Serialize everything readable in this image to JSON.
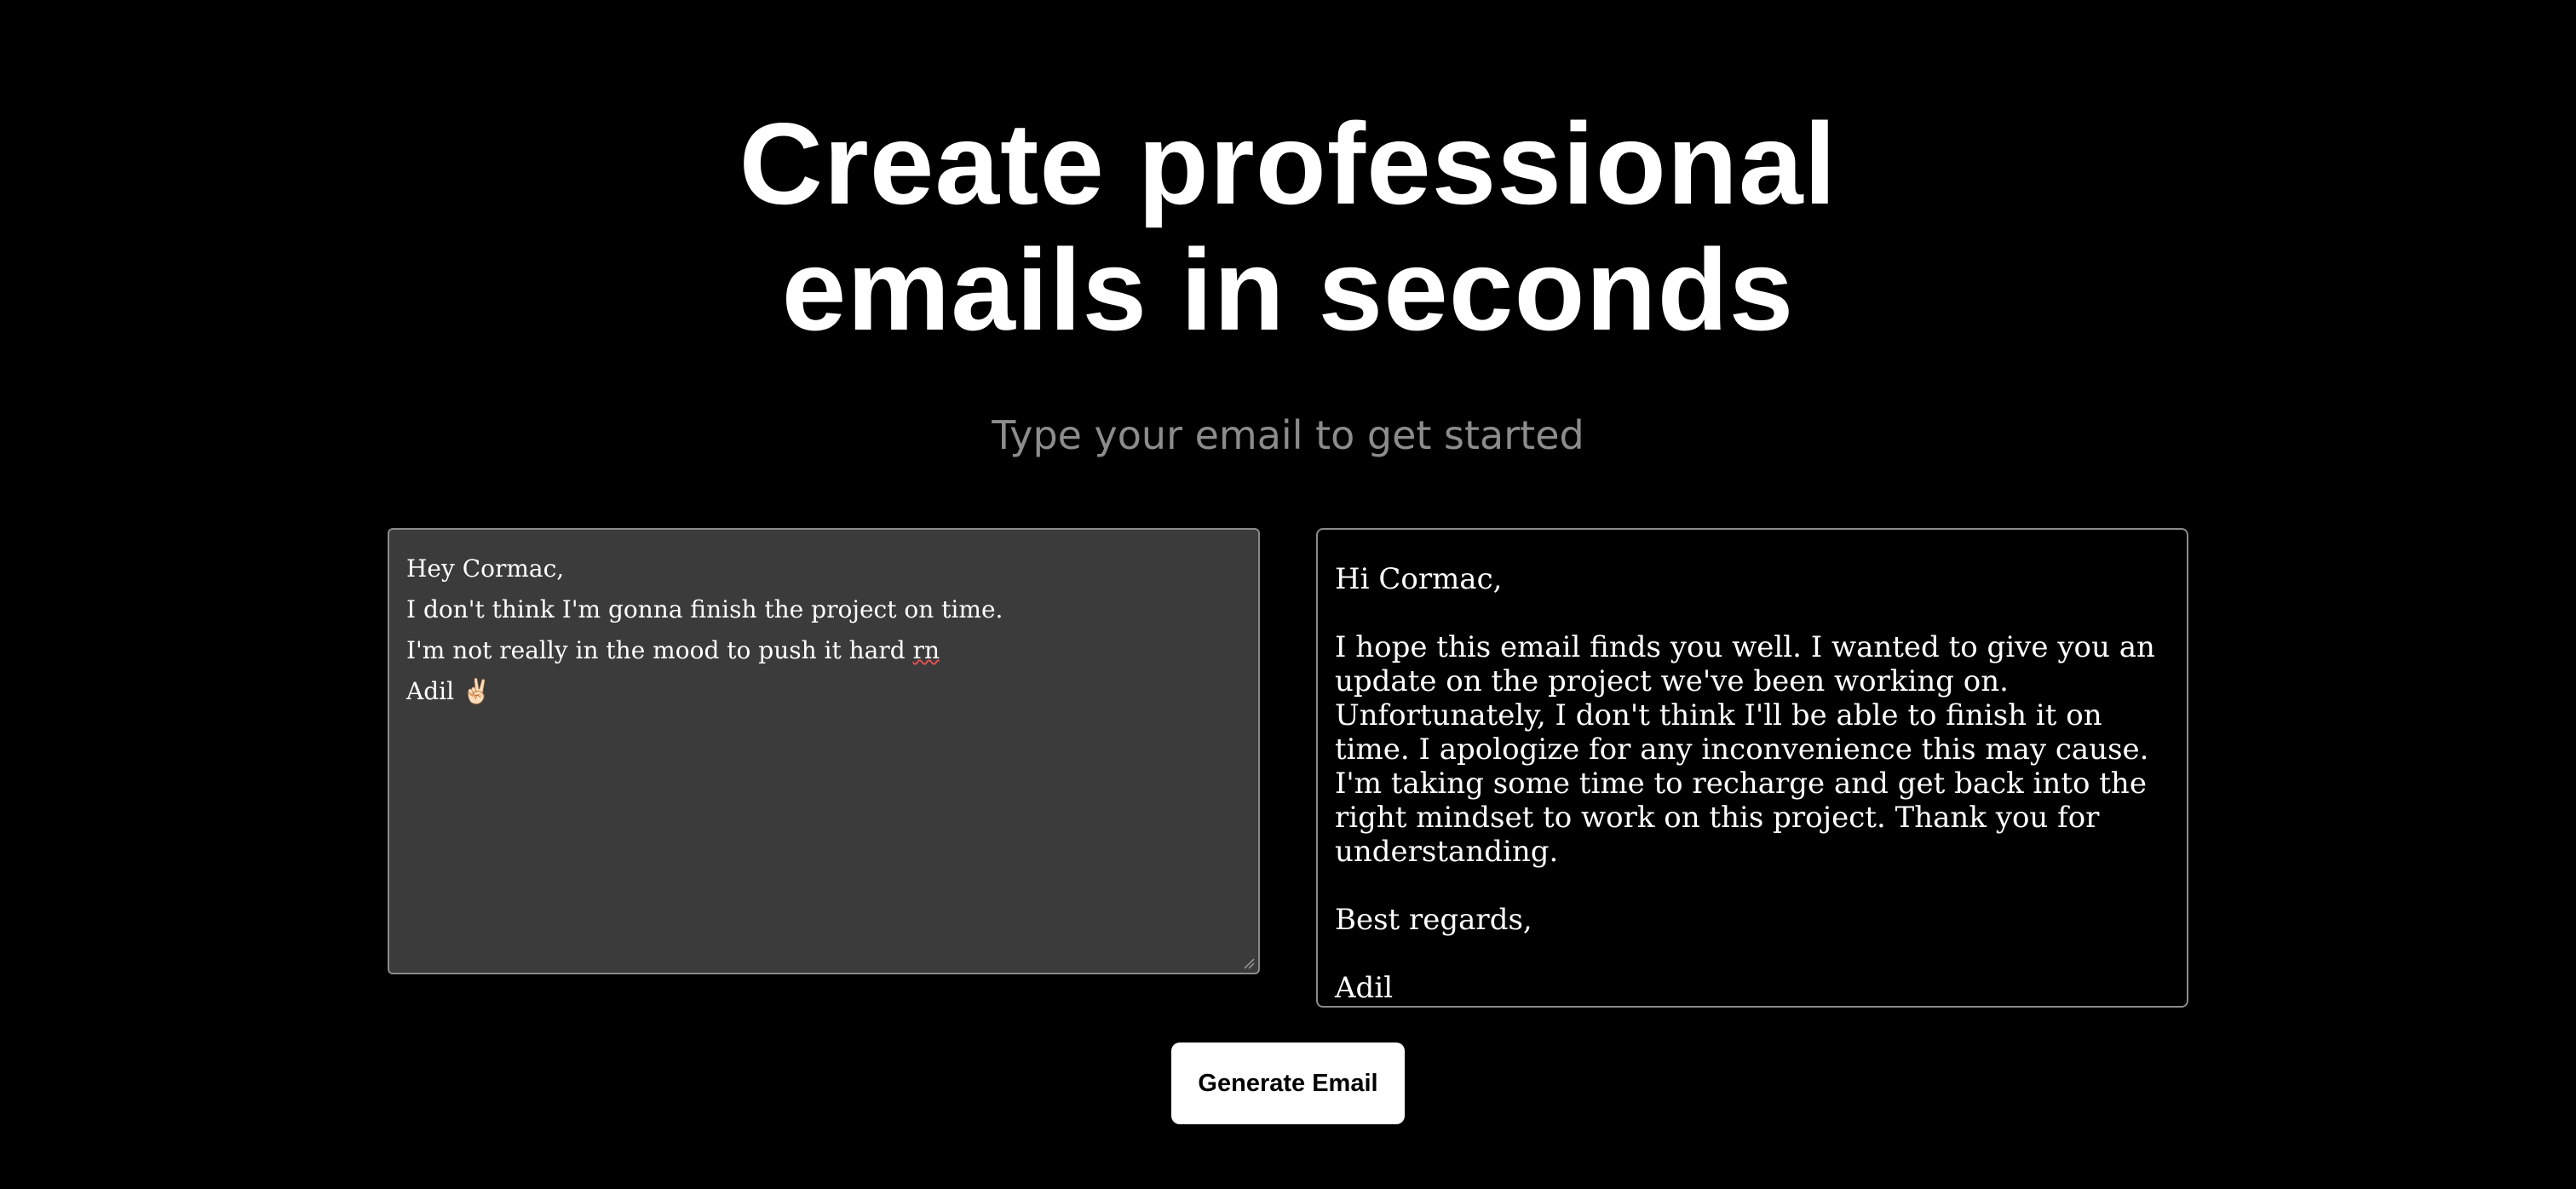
{
  "hero": {
    "title_line1": "Create professional",
    "title_line2": "emails in seconds",
    "subtitle": "Type your email to get started"
  },
  "input": {
    "lines": [
      "Hey Cormac,",
      "I don't think I'm gonna finish the project on time.",
      "I'm not really in the mood to push it hard ",
      "rn",
      "Adil ✌🏻"
    ]
  },
  "output": {
    "greeting": "Hi Cormac,",
    "body": "I hope this email finds you well. I wanted to give you an update on the project we've been working on. Unfortunately, I don't think I'll be able to finish it on time. I apologize for any inconvenience this may cause. I'm taking some time to recharge and get back into the right mindset to work on this project. Thank you for understanding.",
    "closing": "Best regards,",
    "signature": "Adil"
  },
  "actions": {
    "generate_label": "Generate Email"
  },
  "colors": {
    "background": "#000000",
    "text": "#ffffff",
    "subtitle": "#8c8c8c",
    "input_bg": "#3b3b3b",
    "border": "#8a8a8a",
    "button_bg": "#ffffff",
    "button_text": "#000000",
    "spellcheck": "#e05050"
  }
}
